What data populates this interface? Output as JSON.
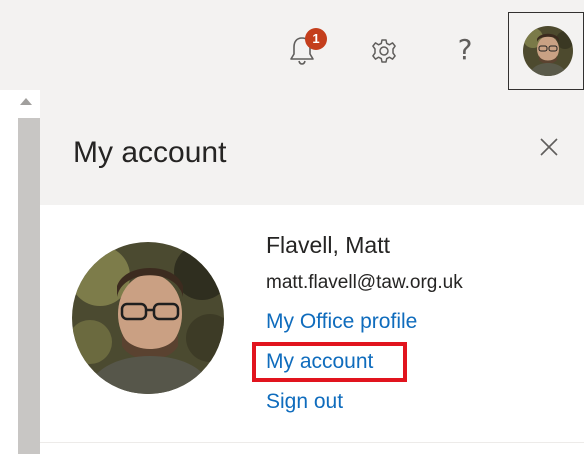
{
  "topbar": {
    "notification_count": "1",
    "icons": [
      "bell-icon",
      "gear-icon",
      "help-icon"
    ],
    "help_glyph": "?"
  },
  "panel": {
    "title": "My account",
    "close_icon": "close-icon"
  },
  "profile": {
    "name": "Flavell, Matt",
    "email": "matt.flavell@taw.org.uk",
    "links": {
      "office_profile": "My Office profile",
      "my_account": "My account",
      "sign_out": "Sign out"
    }
  },
  "colors": {
    "topbar_bg": "#f3f2f1",
    "badge": "#c43e1c",
    "link": "#0f6cbd",
    "highlight": "#e1141e"
  }
}
